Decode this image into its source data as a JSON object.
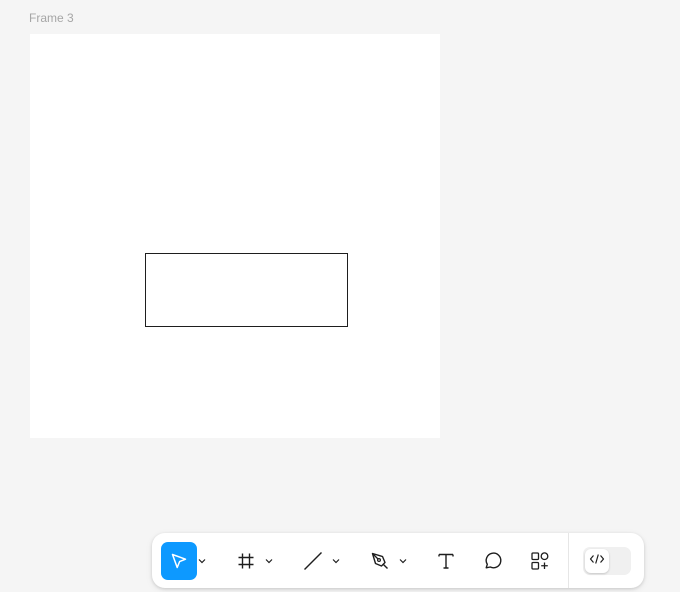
{
  "canvas": {
    "frame_label": "Frame 3",
    "background_color": "#f5f5f5",
    "frame_fill": "#ffffff",
    "shape_stroke": "#1e1e1e"
  },
  "toolbar": {
    "accent_color": "#0d99ff",
    "tools": [
      {
        "name": "move",
        "icon": "cursor-arrow-icon",
        "active": true,
        "has_dropdown": true
      },
      {
        "name": "frame",
        "icon": "frame-hash-icon",
        "active": false,
        "has_dropdown": true
      },
      {
        "name": "line",
        "icon": "line-icon",
        "active": false,
        "has_dropdown": true
      },
      {
        "name": "pen",
        "icon": "pen-icon",
        "active": false,
        "has_dropdown": true
      },
      {
        "name": "text",
        "icon": "text-icon",
        "active": false,
        "has_dropdown": false
      },
      {
        "name": "comment",
        "icon": "comment-bubble-icon",
        "active": false,
        "has_dropdown": false
      },
      {
        "name": "actions",
        "icon": "shapes-plus-icon",
        "active": false,
        "has_dropdown": false
      }
    ],
    "dev_mode": {
      "icon": "code-brackets-icon",
      "enabled": false
    }
  }
}
